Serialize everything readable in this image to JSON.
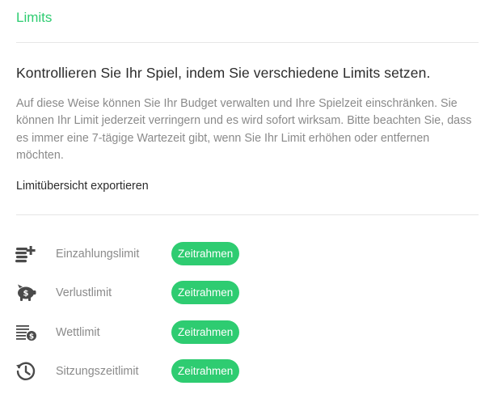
{
  "page": {
    "title": "Limits",
    "headline": "Kontrollieren Sie Ihr Spiel, indem Sie verschiedene Limits setzen.",
    "description": "Auf diese Weise können Sie Ihr Budget verwalten und Ihre Spielzeit einschränken. Sie können Ihr Limit jederzeit verringern und es wird sofort wirksam. Bitte beachten Sie, dass es immer eine 7-tägige Wartezeit gibt, wenn Sie Ihr Limit erhöhen oder entfernen möchten.",
    "export_label": "Limitübersicht exportieren"
  },
  "colors": {
    "accent": "#2ecc71",
    "text": "#2b2b2b",
    "muted": "#8a8a8a",
    "icon": "#4a4a4a"
  },
  "limits": [
    {
      "label": "Einzahlungslimit",
      "button": "Zeitrahmen",
      "icon": "coins-plus-icon"
    },
    {
      "label": "Verlustlimit",
      "button": "Zeitrahmen",
      "icon": "piggy-bank-icon"
    },
    {
      "label": "Wettlimit",
      "button": "Zeitrahmen",
      "icon": "bet-money-icon"
    },
    {
      "label": "Sitzungszeitlimit",
      "button": "Zeitrahmen",
      "icon": "clock-history-icon"
    }
  ]
}
